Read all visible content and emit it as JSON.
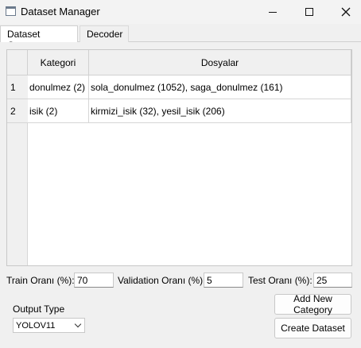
{
  "window": {
    "title": "Dataset Manager"
  },
  "tabs": [
    {
      "label": "Dataset Creator",
      "active": true
    },
    {
      "label": "Decoder",
      "active": false
    }
  ],
  "table": {
    "columns": [
      "Kategori",
      "Dosyalar"
    ],
    "rows": [
      {
        "index": "1",
        "kategori": "donulmez (2)",
        "dosyalar": "sola_donulmez (1052), saga_donulmez (161)"
      },
      {
        "index": "2",
        "kategori": "isik (2)",
        "dosyalar": "kirmizi_isik (32), yesil_isik (206)"
      }
    ]
  },
  "ratios": {
    "train": {
      "label": "Train Oranı (%):",
      "value": "70"
    },
    "validation": {
      "label": "Validation Oranı (%):",
      "value": "5"
    },
    "test": {
      "label": "Test Oranı (%):",
      "value": "25"
    }
  },
  "output": {
    "label": "Output Type",
    "selected": "YOLOV11"
  },
  "buttons": {
    "add_category": "Add New Category",
    "create_dataset": "Create Dataset"
  }
}
